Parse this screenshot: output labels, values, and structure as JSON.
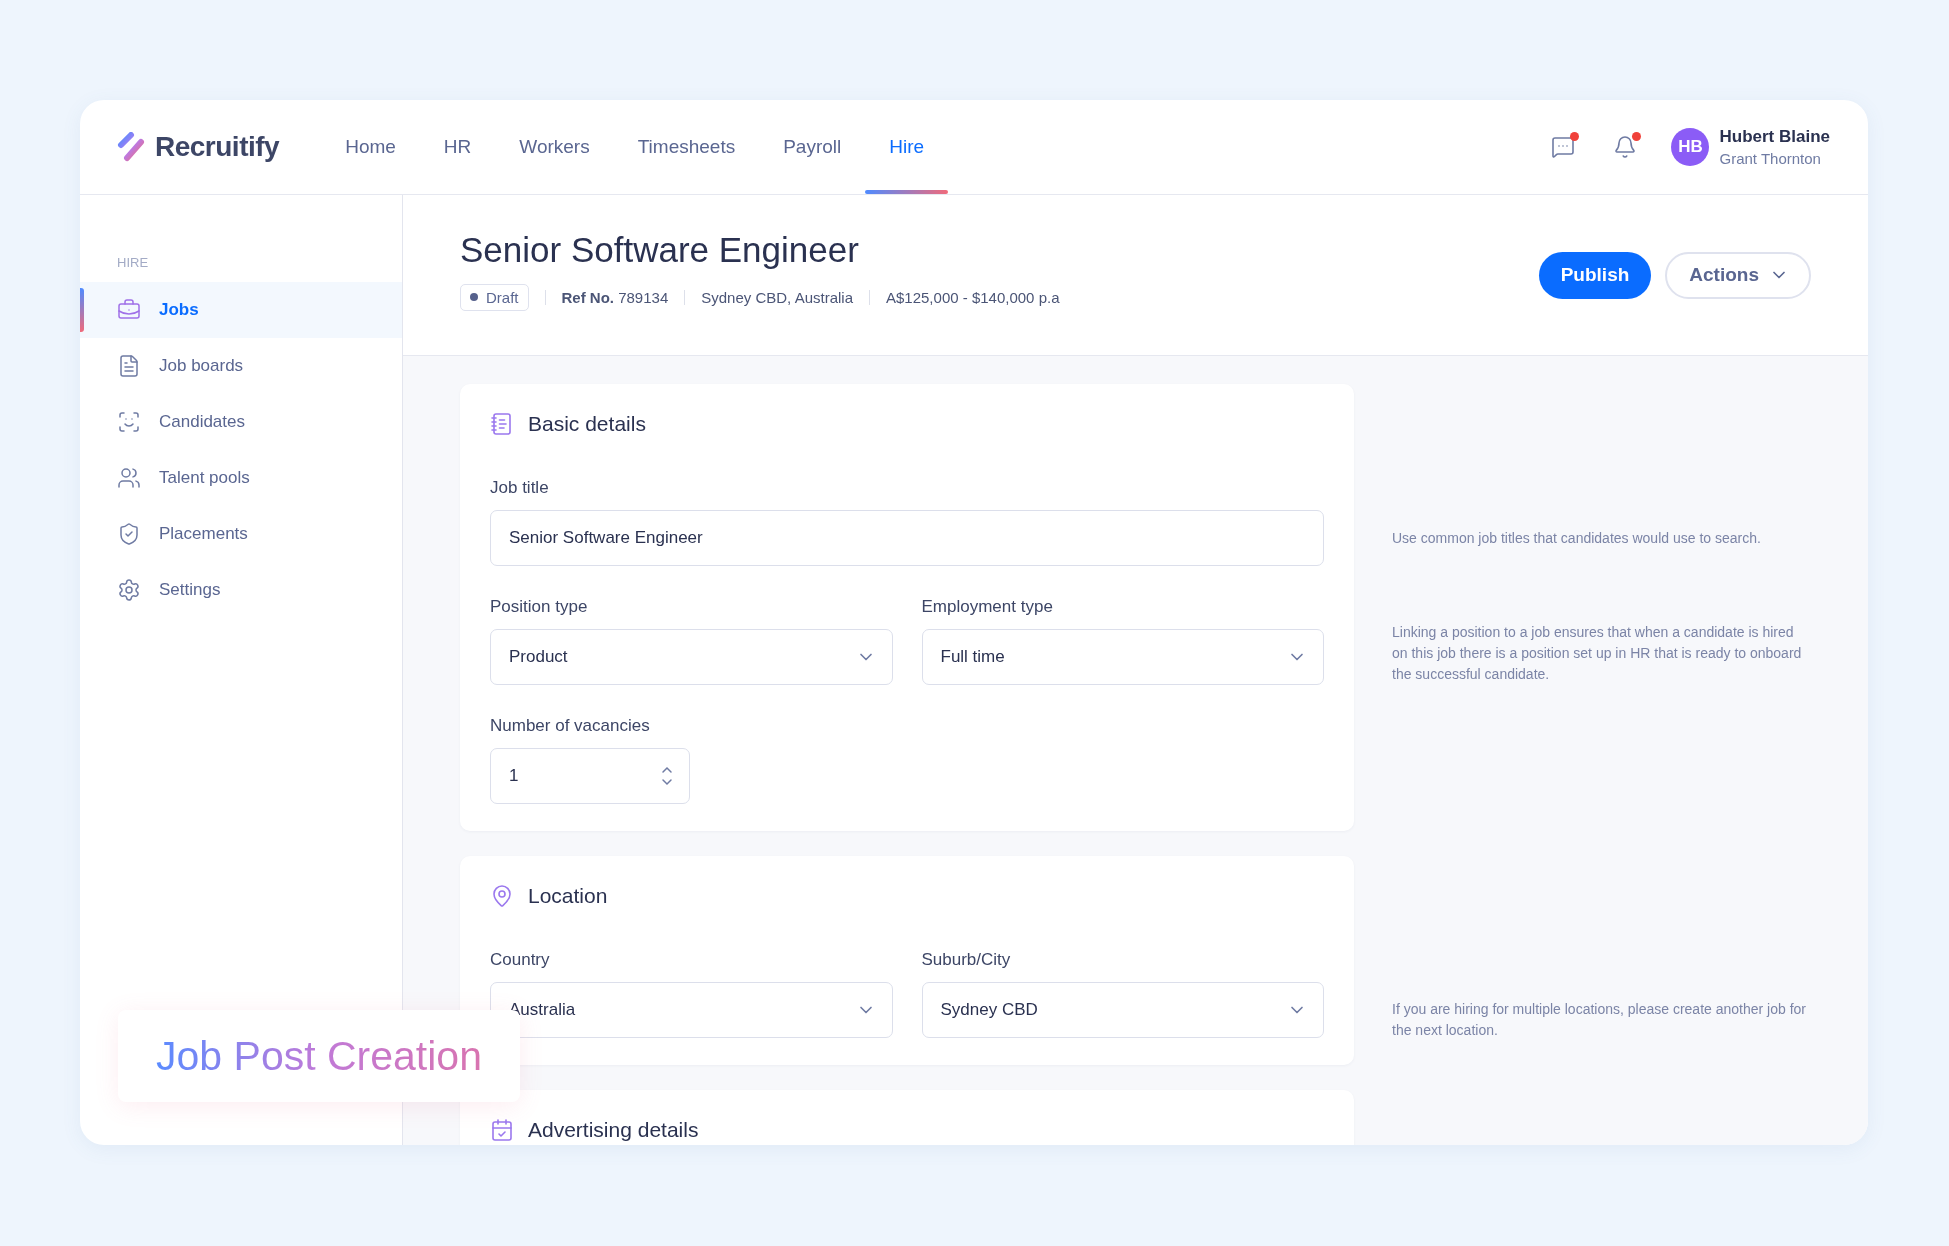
{
  "brand": {
    "name": "Recruitify"
  },
  "nav": [
    {
      "label": "Home",
      "selected": false
    },
    {
      "label": "HR",
      "selected": false
    },
    {
      "label": "Workers",
      "selected": false
    },
    {
      "label": "Timesheets",
      "selected": false
    },
    {
      "label": "Payroll",
      "selected": false
    },
    {
      "label": "Hire",
      "selected": true
    }
  ],
  "header_icons": [
    {
      "kind": "chat",
      "unread": true
    },
    {
      "kind": "bell",
      "unread": true
    }
  ],
  "user": {
    "initials": "HB",
    "name": "Hubert Blaine",
    "company": "Grant Thornton"
  },
  "sidebar": {
    "heading": "HIRE",
    "items": [
      {
        "kind": "briefcase",
        "label": "Jobs",
        "selected": true
      },
      {
        "kind": "board",
        "label": "Job boards",
        "selected": false
      },
      {
        "kind": "person",
        "label": "Candidates",
        "selected": false
      },
      {
        "kind": "group",
        "label": "Talent pools",
        "selected": false
      },
      {
        "kind": "badge",
        "label": "Placements",
        "selected": false
      },
      {
        "kind": "gear",
        "label": "Settings",
        "selected": false
      }
    ]
  },
  "job": {
    "title": "Senior Software Engineer",
    "status": "Draft",
    "ref_label": "Ref No.",
    "ref": "789134",
    "location": "Sydney CBD, Australia",
    "salary": "A$125,000 - $140,000 p.a"
  },
  "actions": [
    {
      "kind": "primary",
      "label": "Publish"
    },
    {
      "kind": "dropdown",
      "label": "Actions"
    }
  ],
  "sections": [
    {
      "kind": "notes",
      "title": "Basic details",
      "rows": [
        {
          "fields": [
            {
              "kind": "text",
              "label": "Job title",
              "value": "Senior Software Engineer"
            }
          ],
          "hint": "Use common job titles that candidates would use to search."
        },
        {
          "fields": [
            {
              "kind": "select",
              "label": "Position type",
              "value": "Product"
            },
            {
              "kind": "select",
              "label": "Employment type",
              "value": "Full time"
            }
          ],
          "hint": "Linking a position to a job ensures that when a candidate is hired on this job there is a position set up in HR that is ready to onboard the successful candidate."
        },
        {
          "fields": [
            {
              "kind": "number",
              "label": "Number of vacancies",
              "value": "1"
            }
          ]
        }
      ]
    },
    {
      "kind": "pin",
      "title": "Location",
      "rows": [
        {
          "fields": [
            {
              "kind": "select",
              "label": "Country",
              "value": "Australia"
            },
            {
              "kind": "select",
              "label": "Suburb/City",
              "value": "Sydney CBD"
            }
          ],
          "hint": "If you are hiring for multiple locations, please create another job for the next location."
        }
      ]
    },
    {
      "kind": "calendar",
      "title": "Advertising details"
    }
  ],
  "caption": "Job Post Creation"
}
